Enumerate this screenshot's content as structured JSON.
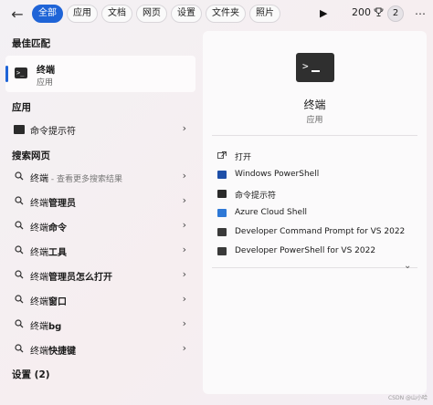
{
  "topbar": {
    "tabs": [
      {
        "label": "全部"
      },
      {
        "label": "应用"
      },
      {
        "label": "文档"
      },
      {
        "label": "网页"
      },
      {
        "label": "设置"
      },
      {
        "label": "文件夹"
      },
      {
        "label": "照片"
      }
    ],
    "points": "200",
    "avatar": "2"
  },
  "left": {
    "best_match_title": "最佳匹配",
    "best_match": {
      "name": "终端",
      "type": "应用"
    },
    "apps_title": "应用",
    "apps": [
      {
        "label": "命令提示符"
      }
    ],
    "web_title": "搜索网页",
    "web": [
      {
        "label": "终端",
        "sub": " - 查看更多搜索结果"
      },
      {
        "prefix": "终端",
        "bold": "管理员"
      },
      {
        "prefix": "终端",
        "bold": "命令"
      },
      {
        "prefix": "终端",
        "bold": "工具"
      },
      {
        "prefix": "终端",
        "bold": "管理员怎么打开"
      },
      {
        "prefix": "终端",
        "bold": "窗口"
      },
      {
        "prefix": "终端",
        "bold": "bg"
      },
      {
        "prefix": "终端",
        "bold": "快捷键"
      }
    ],
    "settings_title": "设置 (2)"
  },
  "right": {
    "app_name": "终端",
    "app_type": "应用",
    "actions": [
      {
        "label": "打开",
        "icon": "open-icon"
      },
      {
        "label": "Windows PowerShell",
        "icon": "powershell-icon"
      },
      {
        "label": "命令提示符",
        "icon": "cmd-icon"
      },
      {
        "label": "Azure Cloud Shell",
        "icon": "azure-icon"
      },
      {
        "label": "Developer Command Prompt for VS 2022",
        "icon": "vs-cmd-icon"
      },
      {
        "label": "Developer PowerShell for VS 2022",
        "icon": "vs-powershell-icon"
      }
    ]
  },
  "watermark": "CSDN @山小哈"
}
